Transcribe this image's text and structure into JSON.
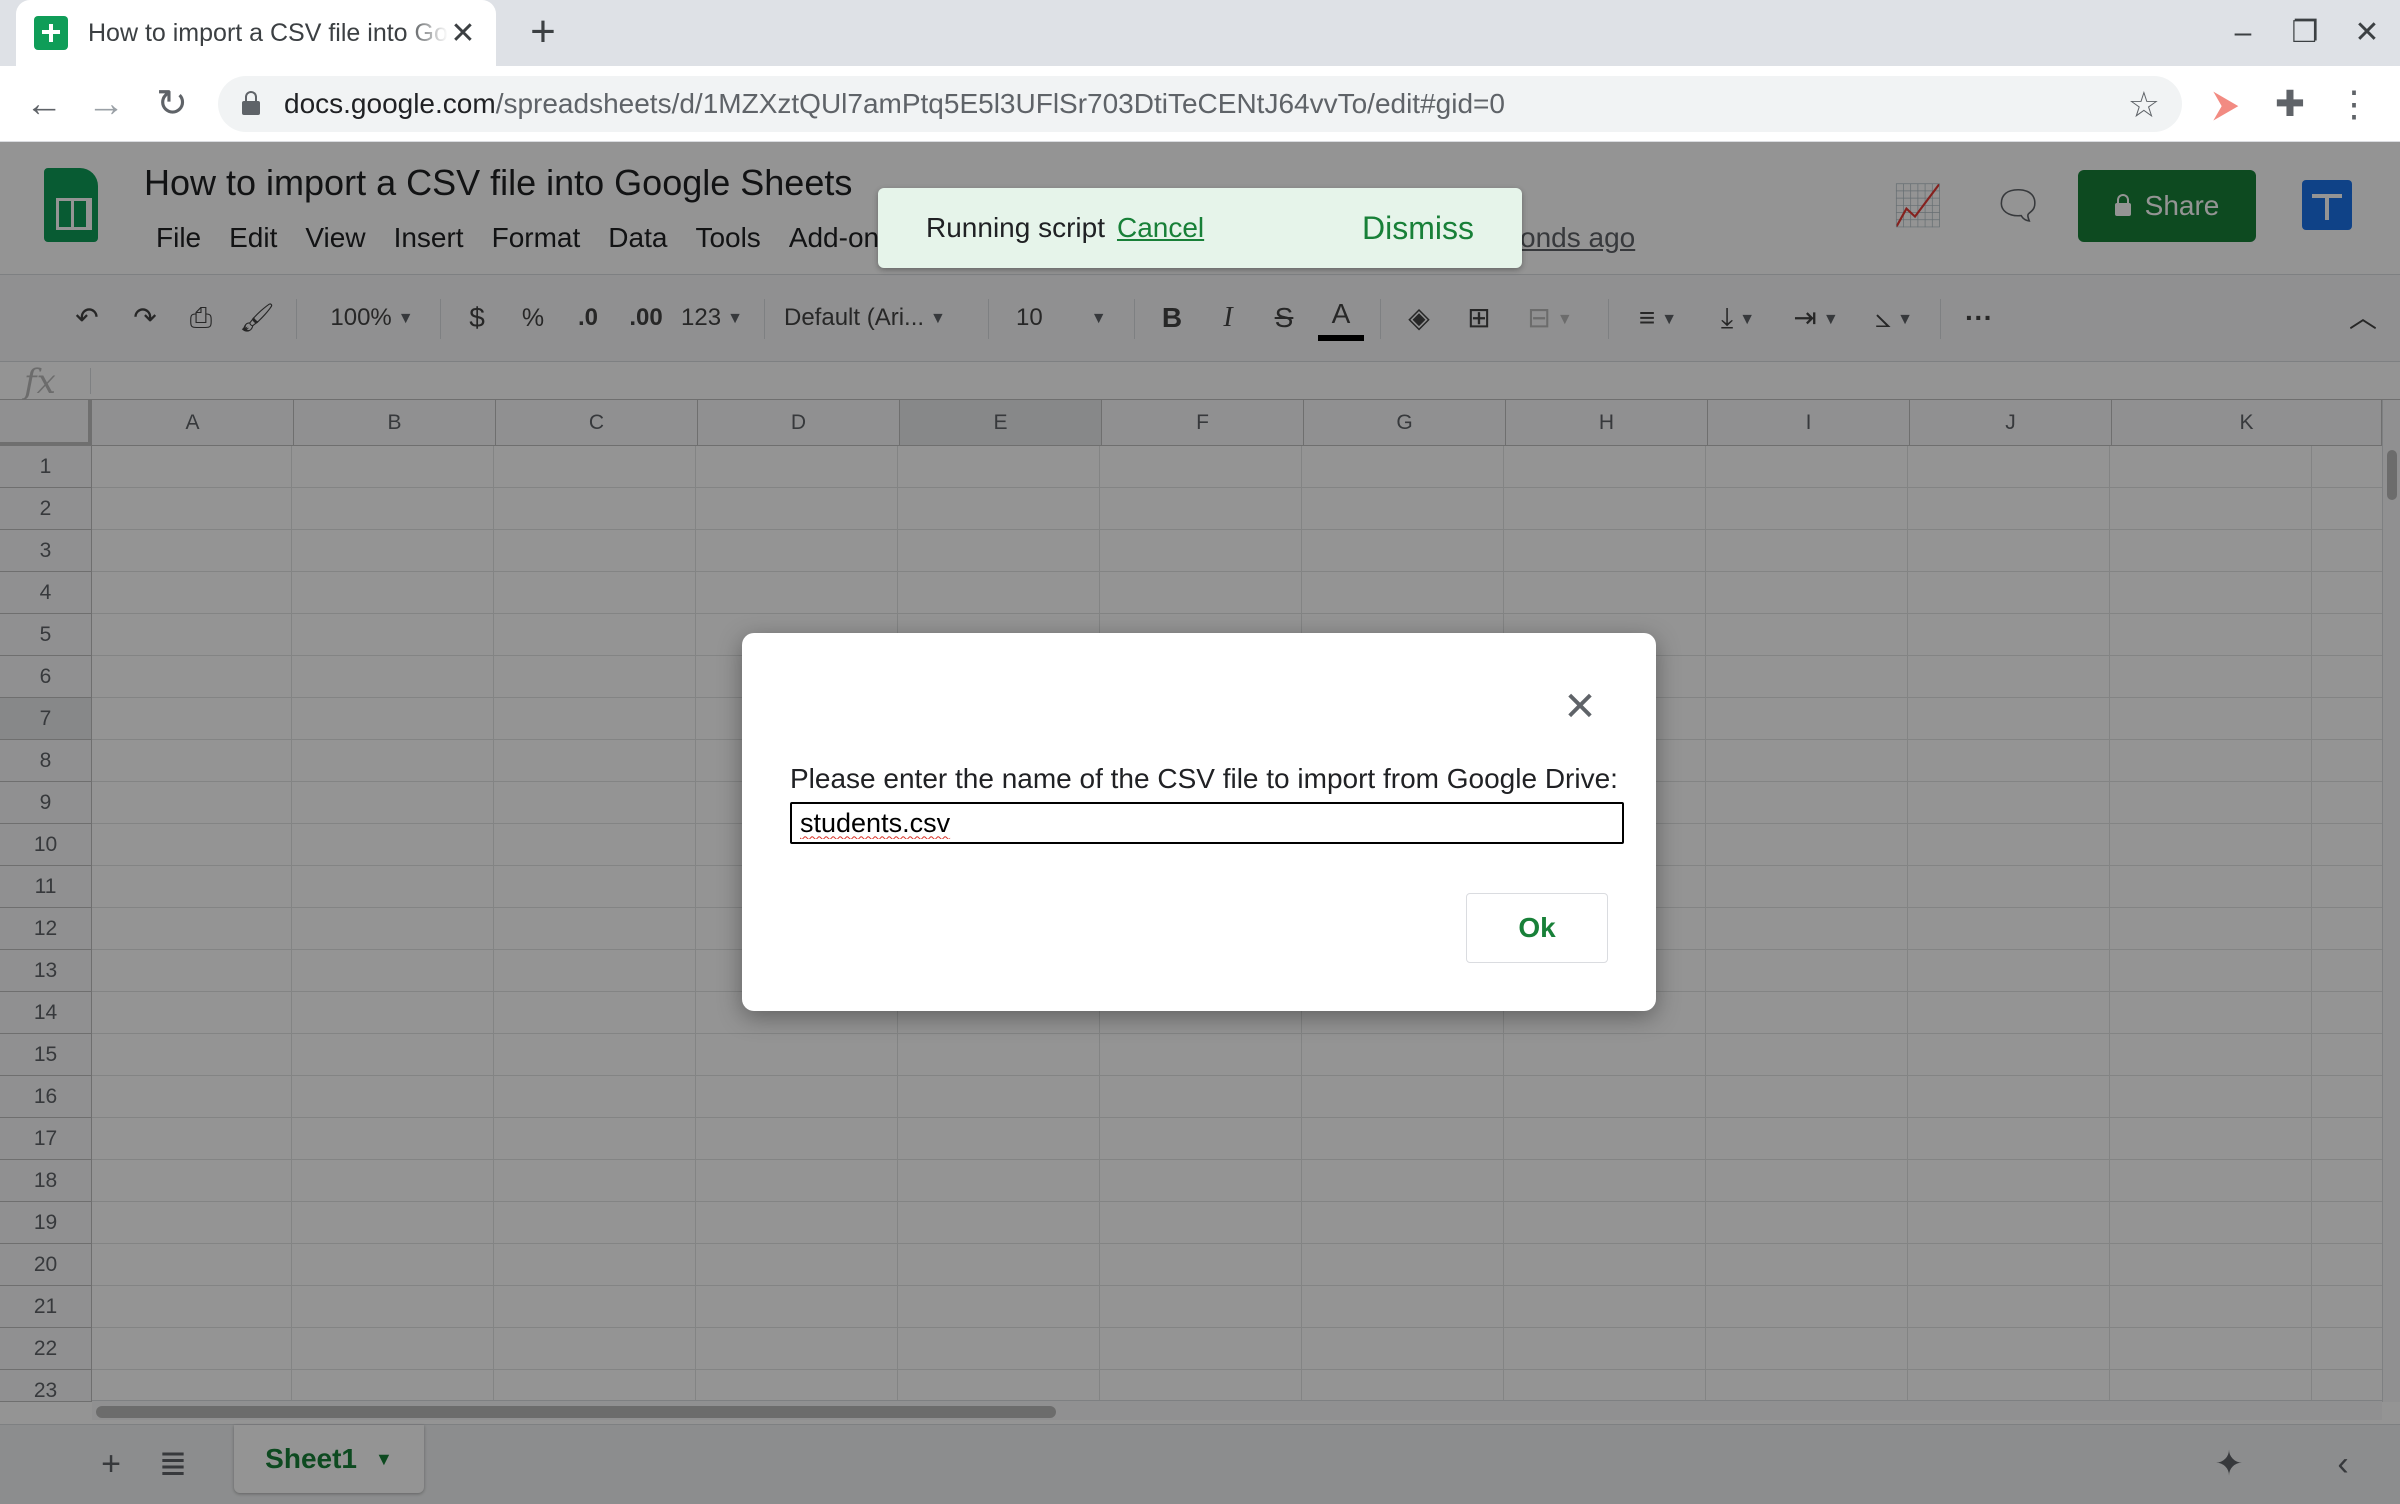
{
  "browser": {
    "tab_title": "How to import a CSV file into Google Sheets",
    "url_host": "docs.google.com",
    "url_path": "/spreadsheets/d/1MZXztQUl7amPtq5E5l3UFlSr703DtiTeCENtJ64vvTo/edit#gid=0"
  },
  "doc": {
    "title": "How to import a CSV file into Google Sheets",
    "menus": [
      "File",
      "Edit",
      "View",
      "Insert",
      "Format",
      "Data",
      "Tools",
      "Add-ons"
    ],
    "last_edit_fragment": "onds ago",
    "share_label": "Share"
  },
  "format_toolbar": {
    "zoom": "100%",
    "currency": "$",
    "percent": "%",
    "decrease_decimal": ".0",
    "increase_decimal": ".00",
    "more_formats": "123",
    "font": "Default (Ari...",
    "font_size": "10"
  },
  "grid": {
    "columns": [
      "A",
      "B",
      "C",
      "D",
      "E",
      "F",
      "G",
      "H",
      "I",
      "J",
      "K"
    ],
    "rows": [
      "1",
      "2",
      "3",
      "4",
      "5",
      "6",
      "7",
      "8",
      "9",
      "10",
      "11",
      "12",
      "13",
      "14",
      "15",
      "16",
      "17",
      "18",
      "19",
      "20",
      "21",
      "22",
      "23"
    ],
    "selected_column": "E",
    "selected_row": "7"
  },
  "sheets": {
    "active": "Sheet1"
  },
  "toast": {
    "message": "Running script",
    "cancel_label": "Cancel",
    "dismiss_label": "Dismiss"
  },
  "dialog": {
    "prompt": "Please enter the name of the CSV file to import from Google Drive:",
    "input_value": "students.csv",
    "ok_label": "Ok"
  },
  "colors": {
    "accent_green": "#188038",
    "sheets_green": "#0f9d58",
    "toast_bg": "#e6f4ea"
  }
}
